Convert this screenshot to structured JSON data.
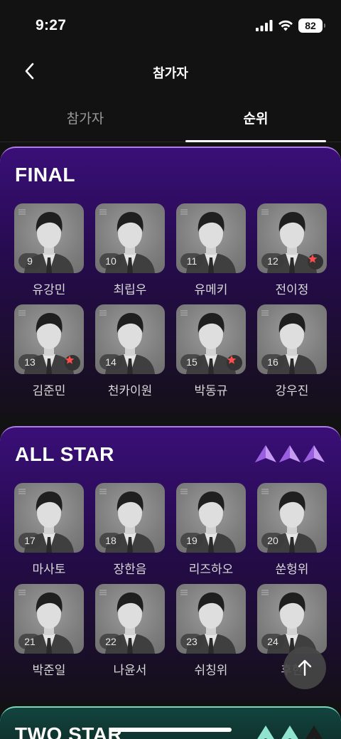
{
  "status": {
    "time": "9:27",
    "battery": "82"
  },
  "nav": {
    "title": "참가자"
  },
  "tabs": [
    {
      "label": "참가자"
    },
    {
      "label": "순위"
    }
  ],
  "sections": [
    {
      "title": "FINAL",
      "participants": [
        {
          "rank": "9",
          "name": "유강민",
          "star": false
        },
        {
          "rank": "10",
          "name": "최립우",
          "star": false
        },
        {
          "rank": "11",
          "name": "유메키",
          "star": false
        },
        {
          "rank": "12",
          "name": "전이정",
          "star": true
        },
        {
          "rank": "13",
          "name": "김준민",
          "star": true
        },
        {
          "rank": "14",
          "name": "천카이원",
          "star": false
        },
        {
          "rank": "15",
          "name": "박동규",
          "star": true
        },
        {
          "rank": "16",
          "name": "강우진",
          "star": false
        }
      ]
    },
    {
      "title": "ALL STAR",
      "tier_icon_color": "#c79bf2",
      "participants": [
        {
          "rank": "17",
          "name": "마사토",
          "star": false
        },
        {
          "rank": "18",
          "name": "장한음",
          "star": false
        },
        {
          "rank": "19",
          "name": "리즈하오",
          "star": false
        },
        {
          "rank": "20",
          "name": "쑨헝위",
          "star": false
        },
        {
          "rank": "21",
          "name": "박준일",
          "star": false
        },
        {
          "rank": "22",
          "name": "나윤서",
          "star": false
        },
        {
          "rank": "23",
          "name": "쉬칭위",
          "star": false
        },
        {
          "rank": "24",
          "name": "후한",
          "star": false
        }
      ]
    },
    {
      "title": "TWO STAR",
      "tier_icon_color": "#8fe3cf"
    }
  ],
  "colors": {
    "accent_purple": "#b07ce8",
    "star_red": "#ff4d4d",
    "accent_mint": "#7ad8c0"
  },
  "icons": {
    "back": "chevron-left-icon",
    "scroll_top": "arrow-up-icon",
    "star": "star-icon"
  }
}
